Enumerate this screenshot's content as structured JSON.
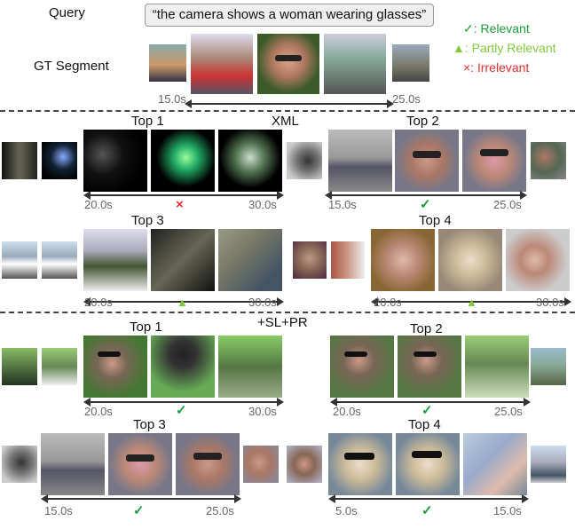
{
  "header": {
    "query_label": "Query",
    "query_text": "“the camera shows a woman wearing glasses”",
    "gt_label": "GT Segment",
    "gt_start": "15.0s",
    "gt_end": "25.0s"
  },
  "legend": {
    "relevant": "✓: Relevant",
    "partly": "▲: Partly Relevant",
    "irrelevant": "×: Irrelevant",
    "colors": {
      "relevant": "#1a9e3a",
      "partly": "#7ec83a",
      "irrelevant": "#e0312f"
    }
  },
  "sections": {
    "xml": "XML",
    "ours": "+SL+PR"
  },
  "xml": {
    "top1": {
      "title": "Top 1",
      "start": "20.0s",
      "end": "30.0s",
      "mark": "×"
    },
    "top2": {
      "title": "Top 2",
      "start": "15.0s",
      "end": "25.0s",
      "mark": "✓"
    },
    "top3": {
      "title": "Top 3",
      "start": "20.0s",
      "end": "30.0s",
      "mark": "▲"
    },
    "top4": {
      "title": "Top 4",
      "start": "20.0s",
      "end": "30.0s",
      "mark": "▲"
    }
  },
  "ours": {
    "top1": {
      "title": "Top 1",
      "start": "20.0s",
      "end": "30.0s",
      "mark": "✓"
    },
    "top2": {
      "title": "Top 2",
      "start": "20.0s",
      "end": "25.0s",
      "mark": "✓"
    },
    "top3": {
      "title": "Top 3",
      "start": "15.0s",
      "end": "25.0s",
      "mark": "✓"
    },
    "top4": {
      "title": "Top 4",
      "start": "5.0s",
      "end": "15.0s",
      "mark": "✓"
    }
  }
}
